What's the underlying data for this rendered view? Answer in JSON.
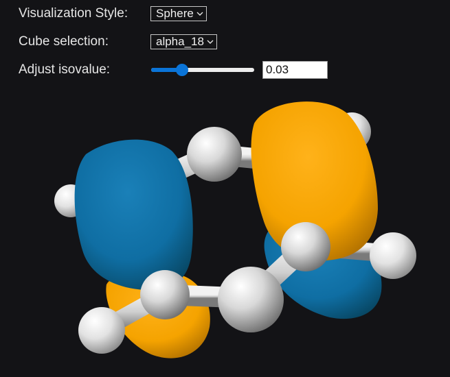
{
  "controls": {
    "style_label": "Visualization Style:",
    "style_value": "Sphere",
    "cube_label": "Cube selection:",
    "cube_value": "alpha_18",
    "iso_label": "Adjust isovalue:",
    "iso_value": "0.03",
    "iso_slider_level": 0.3
  },
  "viewer": {
    "positive_lobe_color": "#f5a300",
    "negative_lobe_color": "#0f6ea3",
    "atom_color": "#d9d9d9"
  }
}
